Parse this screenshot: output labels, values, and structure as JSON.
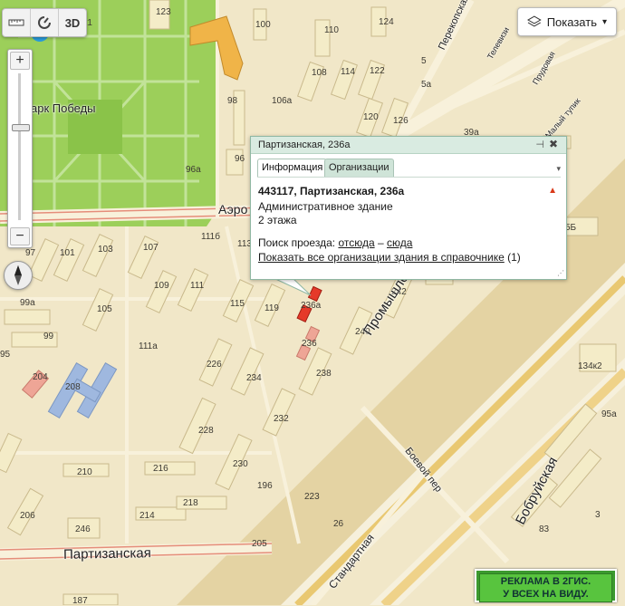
{
  "controls": {
    "ruler_icon": "ruler-icon",
    "traffic_icon": "traffic-icon",
    "mode_3d": "3D",
    "zoom_in": "+",
    "zoom_out": "−",
    "show_label": "Показать",
    "show_caret": "▾"
  },
  "popup": {
    "title": "Партизанская, 236а",
    "tab_info": "Информация",
    "tab_orgs": "Организации",
    "address": "443117, Партизанская, 236а",
    "building_type": "Административное здание",
    "floors": "2 этажа",
    "route_prefix": "Поиск проезда:",
    "route_from": "отсюда",
    "route_dash": "–",
    "route_to": "сюда",
    "all_orgs_link": "Показать все организации здания в справочнике",
    "all_orgs_count": "(1)"
  },
  "ad": {
    "line1": "РЕКЛАМА В 2ГИС.",
    "line2": "У ВСЕХ НА ВИДУ."
  },
  "map": {
    "streets": {
      "partizanskaya": "Партизанская",
      "promyshlennosti": "Промышленности",
      "bobruyskaya": "Бобруйская",
      "standartnaya": "Стандартная",
      "boevoy": "Боевой пер",
      "aero": "Аэро",
      "perekopskaya": "Перекопская",
      "televiz": "Телевизи",
      "prudovaya": "Прудовая",
      "maly_tupik": "Малый тупик",
      "park": "арк Победы"
    },
    "houses": {
      "h123": "123",
      "k1": "к1",
      "h100": "100",
      "h110": "110",
      "h124": "124",
      "h5": "5",
      "h5a": "5а",
      "h108": "108",
      "h114": "114",
      "h122": "122",
      "h98": "98",
      "h106a": "106а",
      "h120": "120",
      "h126": "126",
      "h39a": "39а",
      "h96": "96",
      "h96a": "96а",
      "h97": "97",
      "h101": "101",
      "h103": "103",
      "h107": "107",
      "h111b": "111б",
      "h113": "113",
      "h5b": "5Б",
      "h99a": "99а",
      "h105": "105",
      "h109": "109",
      "h111": "111",
      "h115": "115",
      "h119": "119",
      "h236a": "236а",
      "h242": "242",
      "h99": "99",
      "h111a": "111а",
      "h240": "240",
      "h236": "236",
      "h95": "95",
      "h204": "204",
      "h208": "208",
      "h226": "226",
      "h234": "234",
      "h238": "238",
      "h232": "232",
      "h228": "228",
      "h210": "210",
      "h216": "216",
      "h230": "230",
      "h196": "196",
      "h223": "223",
      "h206": "206",
      "h214": "214",
      "h218": "218",
      "h246": "246",
      "h26": "26",
      "h205": "205",
      "h187": "187",
      "h83": "83",
      "h3": "3",
      "h134k2": "134к2",
      "h95a": "95а"
    }
  }
}
